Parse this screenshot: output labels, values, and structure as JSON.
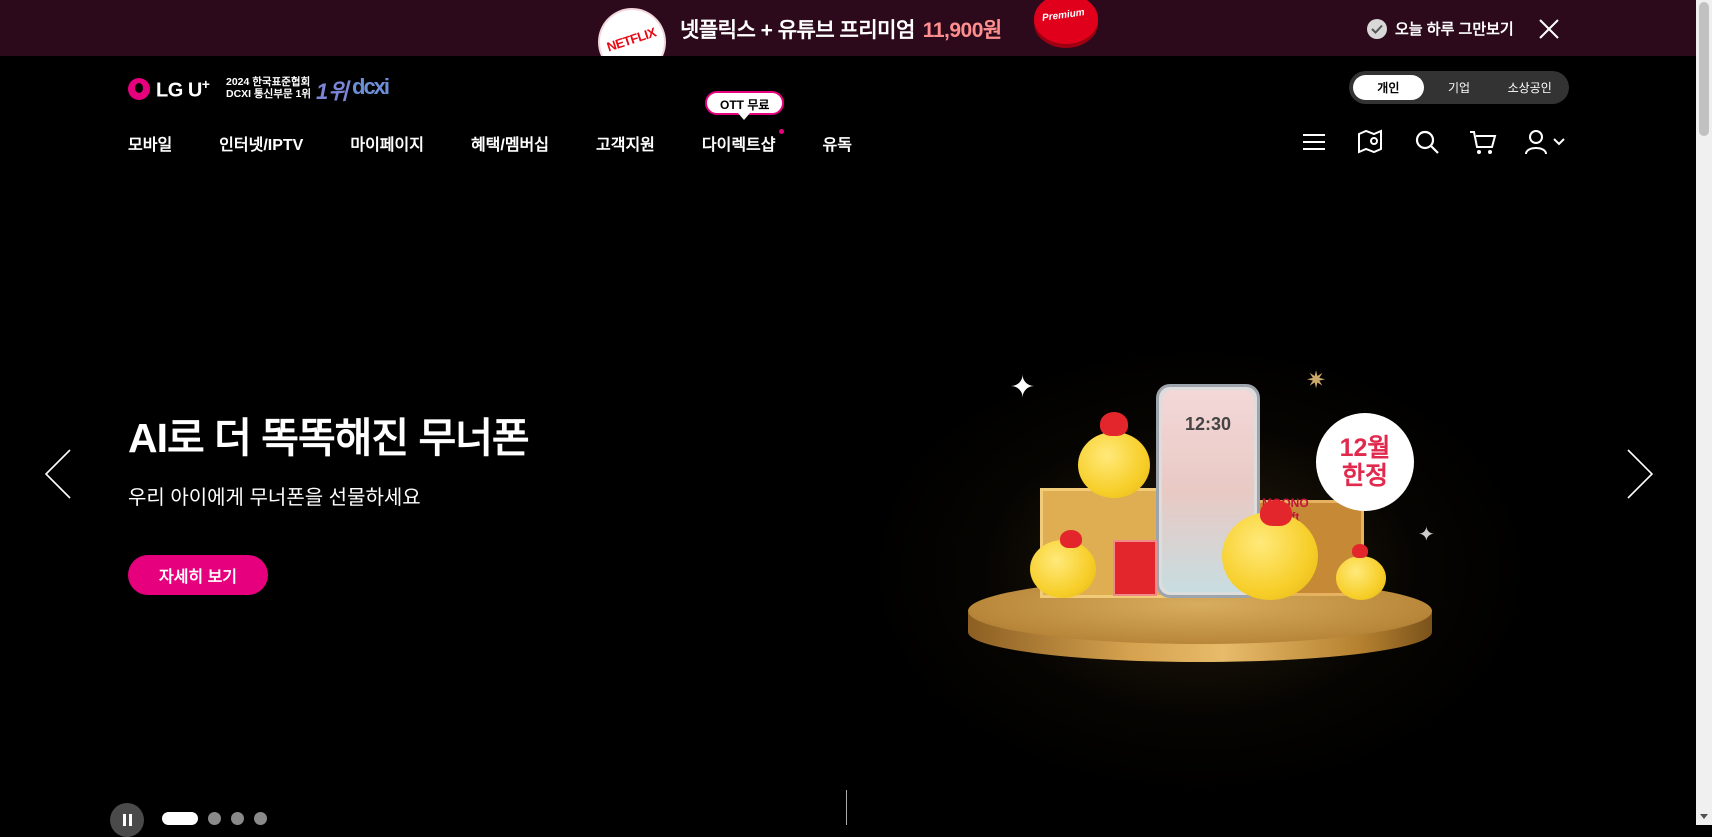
{
  "promo": {
    "netflix_badge": "NETFLIX",
    "text": "넷플릭스 + 유튜브 프리미엄",
    "price": "11,900원",
    "yt_badge": "Premium",
    "dismiss_label": "오늘 하루 그만보기",
    "close_icon": "close-icon"
  },
  "header": {
    "logo_text": "LG U",
    "logo_sup": "+",
    "award_line1": "2024 한국표준협회",
    "award_line2": "DCXI 통신부문 1위",
    "award_rank": "1위",
    "award_logo": "dcxi",
    "segments": [
      {
        "label": "개인",
        "active": true
      },
      {
        "label": "기업",
        "active": false
      },
      {
        "label": "소상공인",
        "active": false
      }
    ],
    "nav": [
      {
        "label": "모바일"
      },
      {
        "label": "인터넷/IPTV"
      },
      {
        "label": "마이페이지"
      },
      {
        "label": "혜택/멤버십"
      },
      {
        "label": "고객지원"
      },
      {
        "label": "다이렉트샵"
      },
      {
        "label": "유독"
      }
    ],
    "ott_tag": "OTT 무료",
    "utility_icons": [
      "menu-icon",
      "store-map-icon",
      "search-icon",
      "cart-icon",
      "user-icon"
    ]
  },
  "hero": {
    "title": "AI로 더 똑똑해진 무너폰",
    "subtitle": "우리 아이에게 무너폰을 선물하세요",
    "cta": "자세히 보기",
    "badge_line1": "12월",
    "badge_line2": "한정",
    "phone_time": "12:30",
    "gift_label_1": "MOONO",
    "gift_label_2": "ial Gift"
  },
  "pager": {
    "count": 4,
    "active_index": 0
  },
  "colors": {
    "brand_magenta": "#e6007e",
    "promo_bg": "#2c0a1c",
    "price_accent": "#ff8f8f"
  }
}
